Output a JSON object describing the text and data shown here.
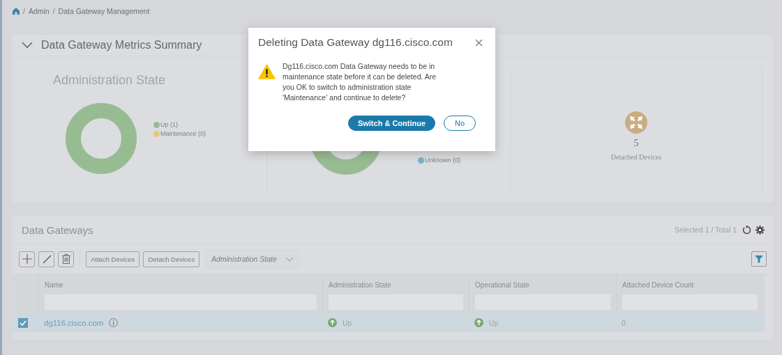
{
  "breadcrumb": {
    "separator": "/",
    "items": [
      "Admin",
      "Data Gateway Management"
    ]
  },
  "metrics_summary": {
    "title": "Data Gateway Metrics Summary",
    "expanded": true,
    "administration_state": {
      "title": "Administration State",
      "legend": [
        {
          "label": "Up (1)",
          "color": "#98bc92"
        },
        {
          "label": "Maintenance (0)",
          "color": "#e3c97c"
        }
      ]
    },
    "operational_state": {
      "legend": [
        {
          "label": "Unknown (0)",
          "color": "#76b3cb"
        }
      ]
    },
    "detached_devices": {
      "count": "5",
      "label": "Detached Devices"
    }
  },
  "data_gateways": {
    "title": "Data Gateways",
    "selection_summary": "Selected 1 / Total 1",
    "toolbar": {
      "buttons": [
        "Attach Devices",
        "Detach Devices"
      ],
      "filter_dropdown": {
        "placeholder": "Administration State"
      }
    },
    "table": {
      "columns": [
        "Name",
        "Administration State",
        "Operational State",
        "Attached Device Count"
      ],
      "rows": [
        {
          "selected": true,
          "name": "dg116.cisco.com",
          "administration_state": "Up",
          "operational_state": "Up",
          "attached_device_count": "0"
        }
      ]
    }
  },
  "dialog": {
    "title": "Deleting Data Gateway dg116.cisco.com",
    "message": "Dg116.cisco.com Data Gateway needs to be in maintenance state before it can be deleted. Are you OK to switch to administration state 'Maintenance' and continue to delete?",
    "buttons": [
      {
        "label": "Switch & Continue",
        "kind": "primary"
      },
      {
        "label": "No",
        "kind": "secondary"
      }
    ]
  }
}
